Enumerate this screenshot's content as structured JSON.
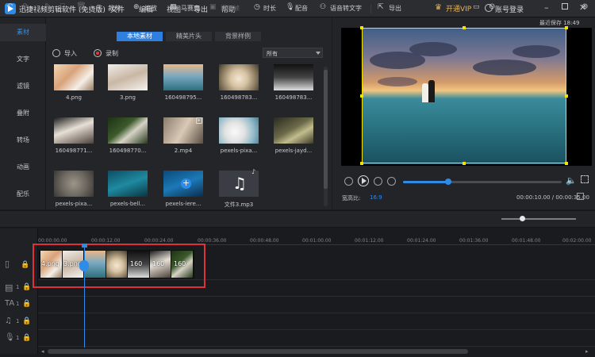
{
  "app": {
    "title": "迅捷视频剪辑软件 (免费版)",
    "menu": [
      "文件",
      "编辑",
      "视图",
      "导出",
      "帮助"
    ],
    "vip_label": "开通VIP",
    "login_label": "账号登录",
    "window_controls": [
      "minimize-icon",
      "maximize-icon",
      "close-icon"
    ]
  },
  "sidebar": {
    "items": [
      {
        "label": "素材",
        "active": true
      },
      {
        "label": "文字",
        "active": false
      },
      {
        "label": "滤镜",
        "active": false
      },
      {
        "label": "叠附",
        "active": false
      },
      {
        "label": "转场",
        "active": false
      },
      {
        "label": "动画",
        "active": false
      },
      {
        "label": "配乐",
        "active": false
      }
    ]
  },
  "library": {
    "tabs": [
      {
        "label": "本地素材",
        "active": true
      },
      {
        "label": "精美片头",
        "active": false
      },
      {
        "label": "背景样例",
        "active": false
      }
    ],
    "import_label": "导入",
    "record_label": "录制",
    "filter_value": "所有",
    "items": [
      {
        "label": "4.png",
        "kind": "image",
        "badge": ""
      },
      {
        "label": "3.png",
        "kind": "image",
        "badge": ""
      },
      {
        "label": "160498795...",
        "kind": "image",
        "badge": ""
      },
      {
        "label": "160498783...",
        "kind": "image",
        "badge": ""
      },
      {
        "label": "160498783...",
        "kind": "image",
        "badge": ""
      },
      {
        "label": "160498771...",
        "kind": "image",
        "badge": ""
      },
      {
        "label": "160498770...",
        "kind": "image",
        "badge": ""
      },
      {
        "label": "2.mp4",
        "kind": "video",
        "badge": "▸"
      },
      {
        "label": "pexels-pixa...",
        "kind": "image",
        "badge": ""
      },
      {
        "label": "pexels-jayd...",
        "kind": "image",
        "badge": ""
      },
      {
        "label": "pexels-pixa...",
        "kind": "image",
        "badge": ""
      },
      {
        "label": "pexels-bell...",
        "kind": "image",
        "badge": ""
      },
      {
        "label": "pexels-iere...",
        "kind": "image",
        "badge": ""
      },
      {
        "label": "文件3.mp3",
        "kind": "audio",
        "badge": "♪"
      }
    ]
  },
  "preview": {
    "autosave": "最近保存 18:49",
    "ratio_label": "宽高比:",
    "ratio_value": "16:9",
    "timecode": "00:00:10.00 / 00:00:35.00",
    "progress": 0.28
  },
  "toolbar": {
    "split": "裁剪",
    "zoom": "缩放",
    "mosaic": "马赛克",
    "add_frame": "添帧帧",
    "duration": "时长",
    "dub": "配音",
    "speech_to_text": "语音转文字",
    "export": "导出",
    "zoom_level": 0.28
  },
  "timeline": {
    "ruler": [
      "00:00:00.00",
      "00:00:12.00",
      "00:00:24.00",
      "00:00:36.00",
      "00:00:48.00",
      "00:01:00.00",
      "00:01:12.00",
      "00:01:24.00",
      "00:01:36.00",
      "00:01:48.00",
      "00:02:00.00"
    ],
    "clips": [
      "4.png",
      "3.png",
      "",
      "",
      "160",
      "160",
      "160",
      ""
    ],
    "track_numbers": [
      "1",
      "1",
      "1",
      "1"
    ]
  }
}
